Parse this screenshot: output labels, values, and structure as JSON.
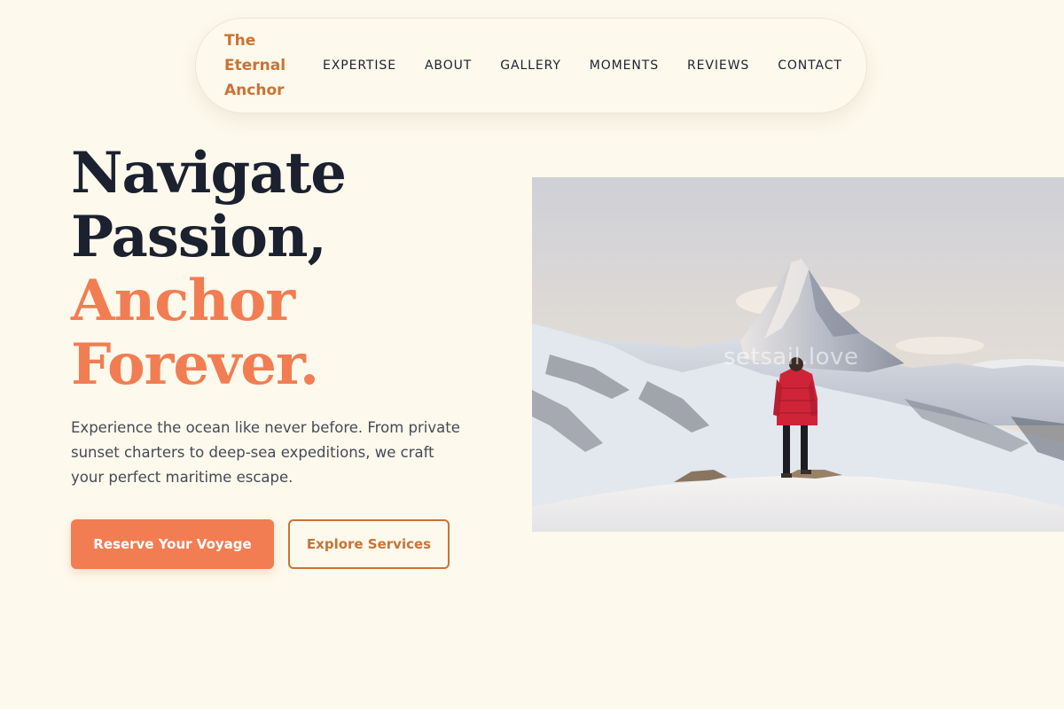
{
  "nav": {
    "brand": "The Eternal Anchor",
    "brand_lines": [
      "The",
      "Eternal",
      "Anchor"
    ],
    "links": [
      "EXPERTISE",
      "ABOUT",
      "GALLERY",
      "MOMENTS",
      "REVIEWS",
      "CONTACT"
    ]
  },
  "hero": {
    "title_lines": [
      "Navigate",
      "Passion,",
      "Anchor",
      "Forever."
    ],
    "description": "Experience the ocean like never before. From private sunset charters to deep-sea expeditions, we craft your perfect maritime escape.",
    "primary_button": "Reserve Your Voyage",
    "secondary_button": "Explore Services",
    "image": {
      "subject": "hiker in red jacket standing before a snowy mountain peak",
      "watermark": "setsail.love"
    }
  },
  "colors": {
    "background": "#fdf9ec",
    "brand": "#c97336",
    "accent": "#f27d52",
    "heading": "#1c2130",
    "body_text": "#454a57"
  }
}
